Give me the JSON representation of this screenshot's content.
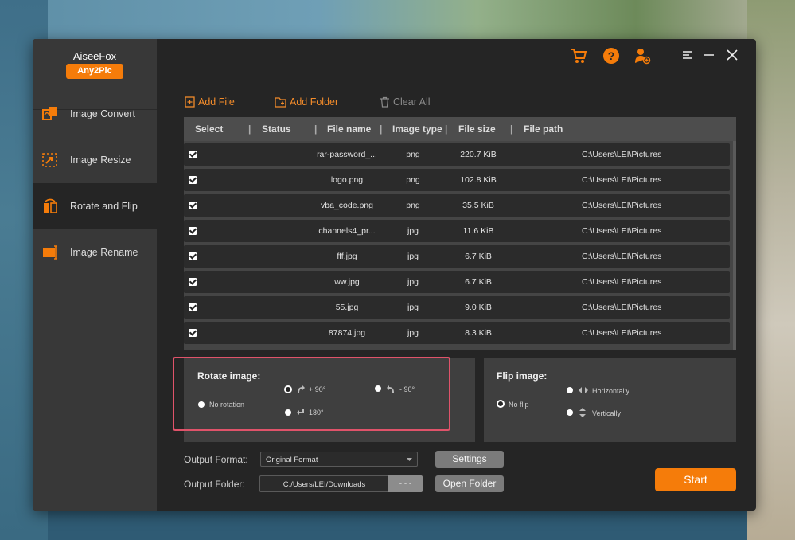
{
  "app": {
    "name": "AiseeFox",
    "product": "Any2Pic"
  },
  "colors": {
    "accent": "#f57c0a",
    "highlight": "#e0536a",
    "window_bg": "#252525",
    "sidebar_bg": "#383838"
  },
  "sidebar": {
    "items": [
      {
        "label": "Image Convert",
        "icon": "image-convert-icon"
      },
      {
        "label": "Image Resize",
        "icon": "image-resize-icon"
      },
      {
        "label": "Rotate and Flip",
        "icon": "rotate-flip-icon",
        "active": true
      },
      {
        "label": "Image Rename",
        "icon": "image-rename-icon"
      }
    ]
  },
  "toolbar": {
    "add_file": "Add File",
    "add_folder": "Add Folder",
    "clear_all": "Clear All"
  },
  "table": {
    "headers": [
      "Select",
      "Status",
      "File name",
      "Image type",
      "File size",
      "File path"
    ],
    "rows": [
      {
        "name": "rar-password_...",
        "type": "png",
        "size": "220.7 KiB",
        "path": "C:\\Users\\LEI\\Pictures",
        "checked": true
      },
      {
        "name": "logo.png",
        "type": "png",
        "size": "102.8 KiB",
        "path": "C:\\Users\\LEI\\Pictures",
        "checked": true
      },
      {
        "name": "vba_code.png",
        "type": "png",
        "size": "35.5 KiB",
        "path": "C:\\Users\\LEI\\Pictures",
        "checked": true
      },
      {
        "name": "channels4_pr...",
        "type": "jpg",
        "size": "11.6 KiB",
        "path": "C:\\Users\\LEI\\Pictures",
        "checked": true
      },
      {
        "name": "fff.jpg",
        "type": "jpg",
        "size": "6.7 KiB",
        "path": "C:\\Users\\LEI\\Pictures",
        "checked": true
      },
      {
        "name": "ww.jpg",
        "type": "jpg",
        "size": "6.7 KiB",
        "path": "C:\\Users\\LEI\\Pictures",
        "checked": true
      },
      {
        "name": "55.jpg",
        "type": "jpg",
        "size": "9.0 KiB",
        "path": "C:\\Users\\LEI\\Pictures",
        "checked": true
      },
      {
        "name": "87874.jpg",
        "type": "jpg",
        "size": "8.3 KiB",
        "path": "C:\\Users\\LEI\\Pictures",
        "checked": true
      }
    ]
  },
  "rotate": {
    "title": "Rotate image:",
    "options": {
      "none": "No rotation",
      "plus90": "+ 90°",
      "minus90": "- 90°",
      "r180": "180°"
    },
    "selected": "plus90"
  },
  "flip": {
    "title": "Flip image:",
    "options": {
      "none": "No flip",
      "horizontal": "Horizontally",
      "vertical": "Vertically"
    },
    "selected": "none"
  },
  "output": {
    "format_label": "Output Format:",
    "format_value": "Original Format",
    "settings_label": "Settings",
    "folder_label": "Output Folder:",
    "folder_value": "C:/Users/LEI/Downloads",
    "browse_label": "- - -",
    "open_folder_label": "Open Folder",
    "start_label": "Start"
  }
}
